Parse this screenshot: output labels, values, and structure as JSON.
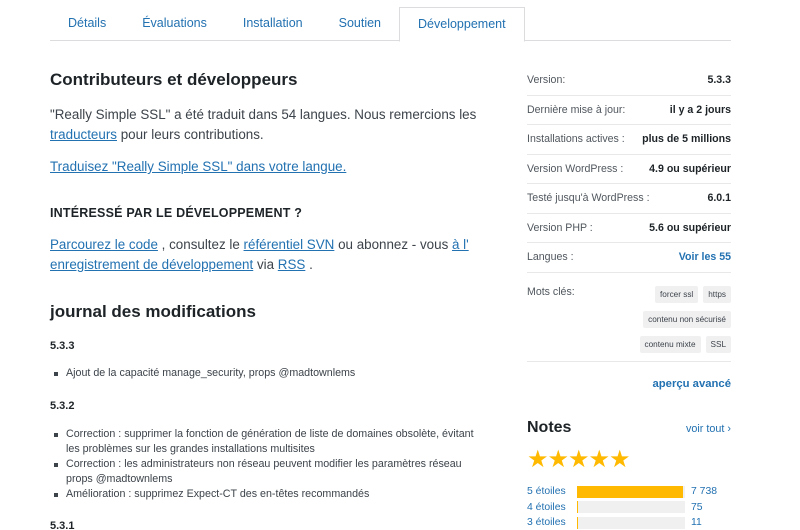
{
  "tabs": [
    {
      "label": "Détails",
      "active": false
    },
    {
      "label": "Évaluations",
      "active": false
    },
    {
      "label": "Installation",
      "active": false
    },
    {
      "label": "Soutien",
      "active": false
    },
    {
      "label": "Développement",
      "active": true
    }
  ],
  "main": {
    "contrib_title": "Contributeurs et développeurs",
    "contrib_text_1": "\"Really Simple SSL\" a été traduit dans 54 langues. Nous remercions les",
    "translators_link": "traducteurs",
    "contrib_text_2": " pour leurs contributions.",
    "translate_link": "Traduisez \"Really Simple SSL\" dans votre langue.",
    "dev_title": "INTÉRESSÉ PAR LE DÉVELOPPEMENT ?",
    "browse_link": "Parcourez le code",
    "dev_text_1": " , consultez le ",
    "svn_link": "référentiel SVN",
    "dev_text_2": " ou abonnez - vous ",
    "log_link": "à l' enregistrement de développement",
    "dev_text_3": " via ",
    "rss_link": "RSS",
    "dev_text_4": " .",
    "changelog_title": "journal des modifications",
    "versions": [
      {
        "version": "5.3.3",
        "items": [
          "Ajout de la capacité manage_security, props @madtownlems"
        ]
      },
      {
        "version": "5.3.2",
        "items": [
          "Correction : supprimer la fonction de génération de liste de domaines obsolète, évitant les problèmes sur les grandes installations multisites",
          "Correction : les administrateurs non réseau peuvent modifier les paramètres réseau props @madtownlems",
          "Amélioration : supprimez Expect-CT des en-têtes recommandés"
        ]
      },
      {
        "version": "5.3.1",
        "items": []
      }
    ]
  },
  "meta": {
    "rows": [
      {
        "key": "Version:",
        "value": "5.3.3",
        "link": false
      },
      {
        "key": "Dernière mise à jour:",
        "value": "il y a 2 jours",
        "link": false
      },
      {
        "key": "Installations actives :",
        "value": "plus de 5 millions",
        "link": false
      },
      {
        "key": "Version WordPress :",
        "value": "4.9 ou supérieur",
        "link": false
      },
      {
        "key": "Testé jusqu'à WordPress :",
        "value": "6.0.1",
        "link": false
      },
      {
        "key": "Version PHP :",
        "value": "5.6 ou supérieur",
        "link": false
      },
      {
        "key": "Langues :",
        "value": "Voir les 55",
        "link": true
      }
    ],
    "tags_label": "Mots clés:",
    "tags": [
      "forcer ssl",
      "https",
      "contenu non sécurisé",
      "contenu mixte",
      "SSL"
    ],
    "advanced_link": "aperçu avancé"
  },
  "ratings": {
    "title": "Notes",
    "see_all": "voir tout",
    "stars": 5,
    "rows": [
      {
        "label": "5 étoiles",
        "count": "7 738",
        "fraction": 0.98
      },
      {
        "label": "4 étoiles",
        "count": "75",
        "fraction": 0.01
      },
      {
        "label": "3 étoiles",
        "count": "11",
        "fraction": 0.005
      }
    ]
  },
  "colors": {
    "accent": "#2271b1",
    "star": "#ffb900"
  }
}
